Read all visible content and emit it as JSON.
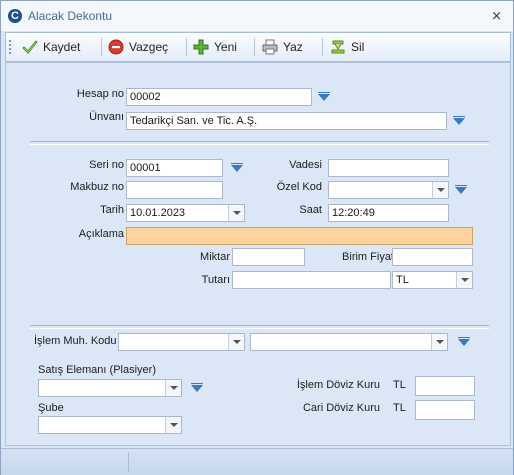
{
  "window": {
    "title": "Alacak Dekontu",
    "close_glyph": "⨯"
  },
  "toolbar": {
    "save_label": "Kaydet",
    "cancel_label": "Vazgeç",
    "new_label": "Yeni",
    "print_label": "Yaz",
    "delete_label": "Sil"
  },
  "account": {
    "hesap_no_label": "Hesap no",
    "hesap_no_value": "00002",
    "unvan_label": "Ünvanı",
    "unvan_value": "Tedarikçi San. ve Tic. A.Ş."
  },
  "document": {
    "seri_no_label": "Seri no",
    "seri_no_value": "00001",
    "vadesi_label": "Vadesi",
    "vadesi_value": "",
    "makbuz_no_label": "Makbuz no",
    "makbuz_no_value": "",
    "ozel_kod_label": "Özel Kod",
    "ozel_kod_value": "",
    "tarih_label": "Tarih",
    "tarih_value": "10.01.2023",
    "saat_label": "Saat",
    "saat_value": "12:20:49",
    "aciklama_label": "Açıklama",
    "aciklama_value": "",
    "miktar_label": "Miktar",
    "miktar_value": "",
    "birim_fiyat_label": "Birim Fiyat",
    "birim_fiyat_value": "",
    "tutari_label": "Tutarı",
    "tutari_value": "",
    "currency_value": "TL"
  },
  "bottom": {
    "islem_muh_kodu_label": "İşlem Muh. Kodu",
    "islem_muh_kodu_value": "",
    "islem_muh_kodu_desc_value": "",
    "satis_elemani_label": "Satış Elemanı (Plasiyer)",
    "satis_elemani_value": "",
    "sube_label": "Şube",
    "sube_value": "",
    "islem_doviz_kuru_label": "İşlem Döviz Kuru",
    "islem_doviz_currency": "TL",
    "islem_doviz_kuru_value": "",
    "cari_doviz_kuru_label": "Cari Döviz Kuru",
    "cari_doviz_currency": "TL",
    "cari_doviz_kuru_value": ""
  },
  "icons": {
    "app": "app-logo-icon",
    "save": "checkmark-icon",
    "cancel": "stop-icon",
    "new": "plus-icon",
    "print": "printer-icon",
    "delete": "delete-icon",
    "lookup": "lookup-arrow-icon"
  },
  "colors": {
    "window_bg": "#d9e6f5",
    "required_field": "#fbd39b",
    "lookup_arrow": "#3a7ac4",
    "title_text": "#4b6a92"
  }
}
